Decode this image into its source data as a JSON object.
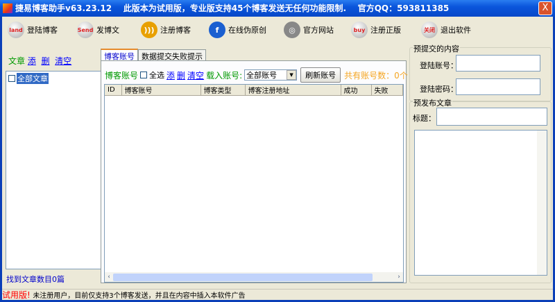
{
  "window": {
    "title": "捷易博客助手v63.23.12    此版本为试用版，专业版支持45个博客发送无任何功能限制.    官方QQ：593811385",
    "close": "X"
  },
  "toolbar": [
    {
      "label": "登陆博客",
      "icon": "land",
      "color": "#d22"
    },
    {
      "label": "发博文",
      "icon": "Send",
      "color": "#d22"
    },
    {
      "label": "注册博客",
      "icon": "rss-icon",
      "color": "#e8a000"
    },
    {
      "label": "在线伪原创",
      "icon": "facebook-icon",
      "color": "#1a5fd0"
    },
    {
      "label": "官方网站",
      "icon": "globe-icon",
      "color": "#888"
    },
    {
      "label": "注册正版",
      "icon": "buy",
      "color": "#d22"
    },
    {
      "label": "退出软件",
      "icon": "关闭",
      "color": "#d22"
    }
  ],
  "left": {
    "label": "文章",
    "add": "添",
    "del": "删",
    "clear": "清空",
    "tree_root": "全部文章",
    "count": "找到文章数目0篇"
  },
  "tabs": [
    {
      "label": "博客账号",
      "active": true
    },
    {
      "label": "数据提交失败提示",
      "active": false
    }
  ],
  "accounts": {
    "label": "博客账号",
    "select_all": "全选",
    "add": "添",
    "del": "删",
    "clear": "清空",
    "load_label": "载入账号:",
    "load_value": "全部账号",
    "refresh": "刷新账号",
    "total": "共有账号数：0个",
    "columns": [
      "ID",
      "博客账号",
      "博客类型",
      "博客注册地址",
      "成功",
      "失败"
    ]
  },
  "right": {
    "group1": "预提交的内容",
    "login_account": "登陆账号：",
    "login_password": "登陆密码：",
    "group2": "预发布文章",
    "title_label": "标题："
  },
  "status": {
    "trial": "试用版!",
    "message": "未注册用户，目前仅支持3个博客发送，并且在内容中插入本软件广告"
  }
}
